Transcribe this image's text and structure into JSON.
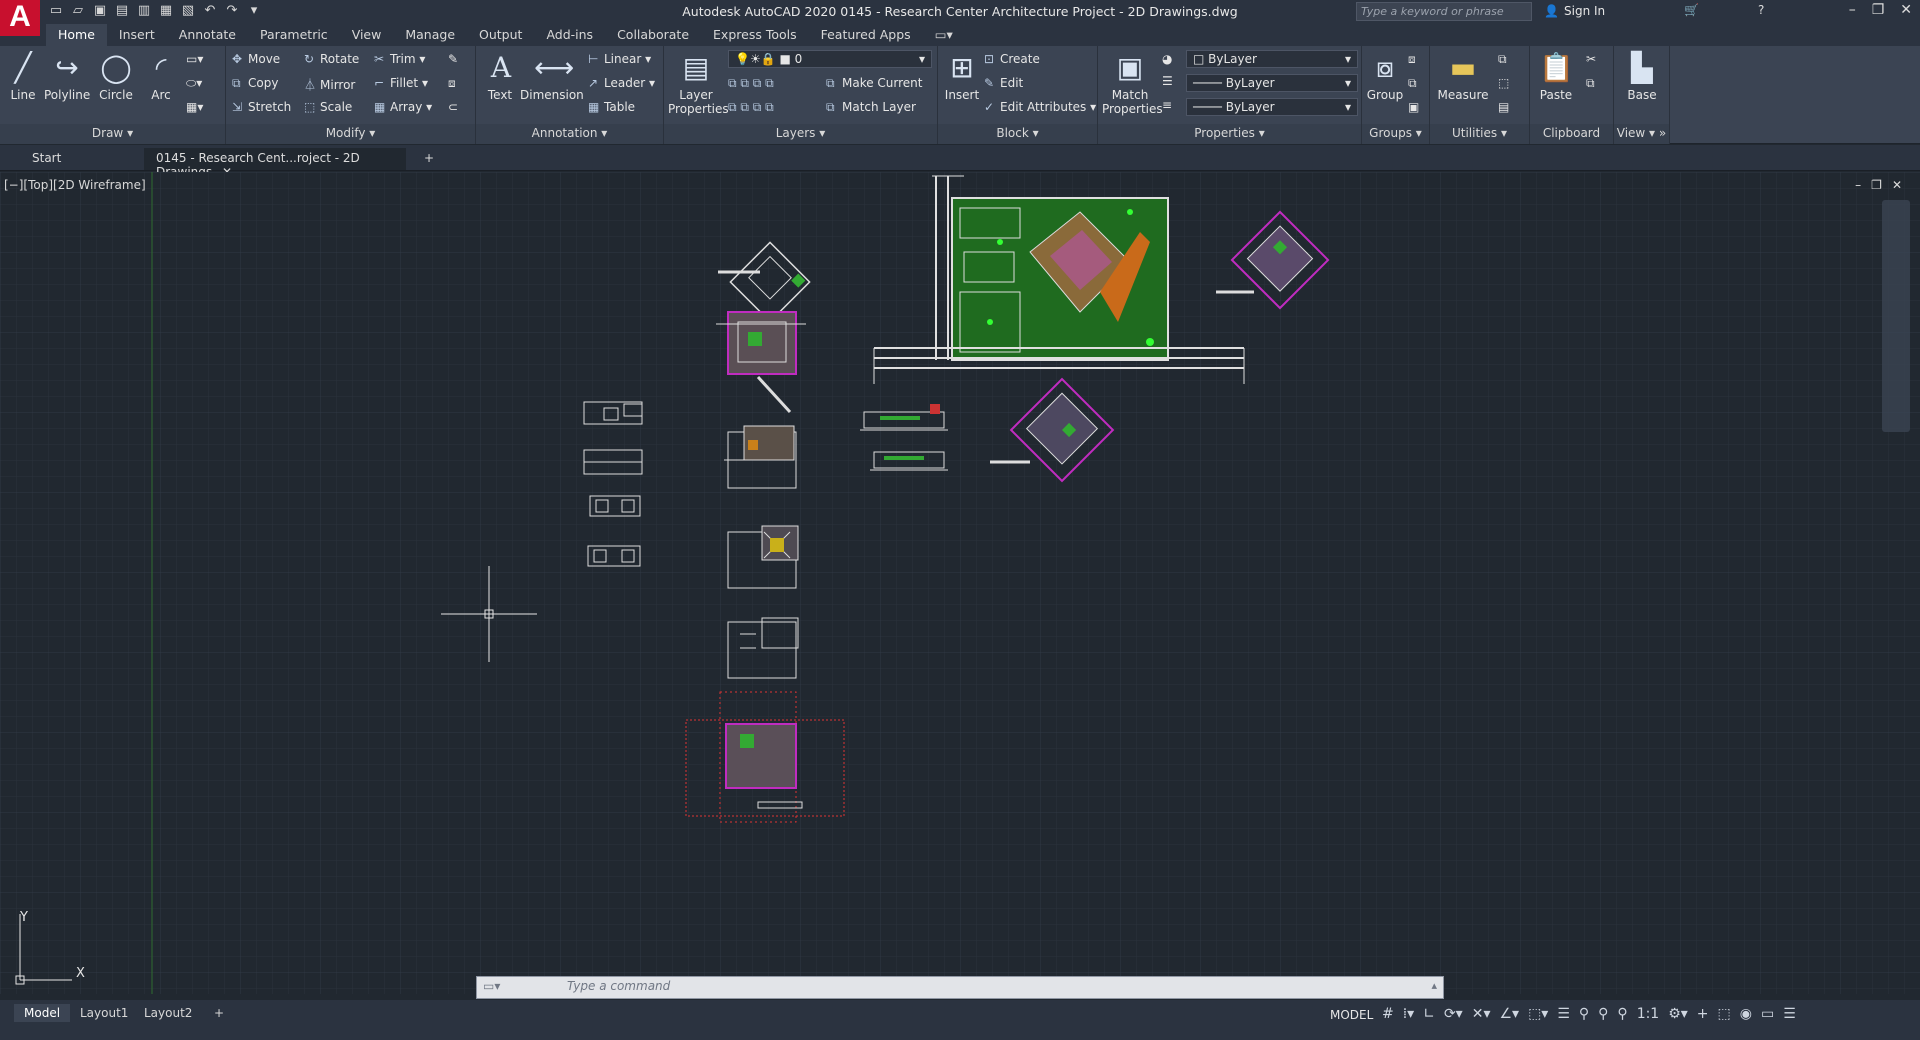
{
  "app": {
    "logo": "A",
    "title": "Autodesk AutoCAD 2020   0145 - Research Center  Architecture Project - 2D Drawings.dwg",
    "search_placeholder": "Type a keyword or phrase",
    "sign_in": "Sign In"
  },
  "ribbon_tabs": [
    "Home",
    "Insert",
    "Annotate",
    "Parametric",
    "View",
    "Manage",
    "Output",
    "Add-ins",
    "Collaborate",
    "Express Tools",
    "Featured Apps"
  ],
  "draw": {
    "line": "Line",
    "polyline": "Polyline",
    "circle": "Circle",
    "arc": "Arc",
    "title": "Draw"
  },
  "modify": {
    "move": "Move",
    "rotate": "Rotate",
    "trim": "Trim",
    "copy": "Copy",
    "mirror": "Mirror",
    "fillet": "Fillet",
    "stretch": "Stretch",
    "scale": "Scale",
    "array": "Array",
    "title": "Modify"
  },
  "annotation": {
    "text": "Text",
    "dimension": "Dimension",
    "linear": "Linear",
    "leader": "Leader",
    "table": "Table",
    "title": "Annotation"
  },
  "layers": {
    "layer_properties_1": "Layer",
    "layer_properties_2": "Properties",
    "current_layer": "0",
    "make_current": "Make Current",
    "match_layer": "Match Layer",
    "title": "Layers"
  },
  "block": {
    "insert": "Insert",
    "create": "Create",
    "edit": "Edit",
    "edit_attributes": "Edit Attributes",
    "title": "Block"
  },
  "properties": {
    "match_1": "Match",
    "match_2": "Properties",
    "color": "ByLayer",
    "linetype": "ByLayer",
    "lineweight": "ByLayer",
    "title": "Properties"
  },
  "groups": {
    "group": "Group",
    "title": "Groups"
  },
  "utilities": {
    "measure": "Measure",
    "title": "Utilities"
  },
  "clipboard": {
    "paste": "Paste",
    "title": "Clipboard"
  },
  "view": {
    "base": "Base",
    "title": "View"
  },
  "doc_tabs": {
    "start": "Start",
    "active": "0145 - Research Cent...roject - 2D Drawings",
    "close": "✕",
    "add": "+"
  },
  "viewport": {
    "label": "[−][Top][2D Wireframe]",
    "ucs_y": "Y",
    "ucs_x": "X"
  },
  "command": {
    "placeholder": "Type  a  command"
  },
  "layout_tabs": [
    "Model",
    "Layout1",
    "Layout2"
  ],
  "status": {
    "model": "MODEL",
    "scale": "1:1"
  },
  "colors": {
    "accent": "#c8102e",
    "canvas": "#212830",
    "ribbon": "#3b4453"
  }
}
